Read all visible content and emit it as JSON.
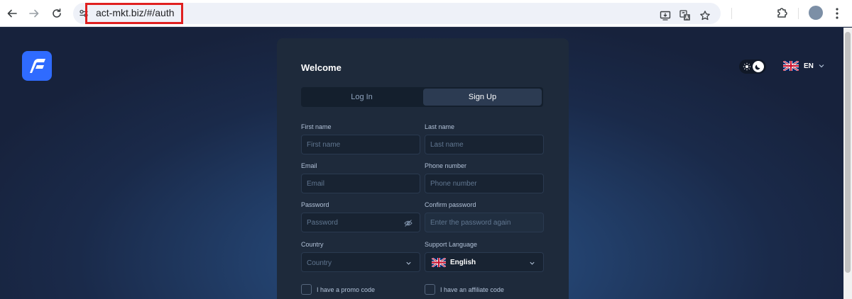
{
  "browser": {
    "url": "act-mkt.biz/#/auth"
  },
  "header": {
    "language_code": "EN"
  },
  "auth": {
    "title": "Welcome",
    "tabs": {
      "login": "Log In",
      "signup": "Sign Up"
    },
    "fields": {
      "first_name": {
        "label": "First name",
        "placeholder": "First name"
      },
      "last_name": {
        "label": "Last name",
        "placeholder": "Last name"
      },
      "email": {
        "label": "Email",
        "placeholder": "Email"
      },
      "phone": {
        "label": "Phone number",
        "placeholder": "Phone number"
      },
      "password": {
        "label": "Password",
        "placeholder": "Password"
      },
      "confirm_password": {
        "label": "Confirm password",
        "placeholder": "Enter the password again"
      },
      "country": {
        "label": "Country",
        "value": "Country"
      },
      "support_language": {
        "label": "Support Language",
        "value": "English"
      }
    },
    "checkboxes": {
      "promo": "I have a promo code",
      "affiliate": "I have an affiliate code"
    }
  },
  "icons": {
    "back": "arrow-left-icon",
    "forward": "arrow-right-icon",
    "reload": "reload-icon",
    "site_info": "site-info-icon",
    "install": "install-app-icon",
    "translate": "translate-icon",
    "bookmark": "star-icon",
    "extensions": "puzzle-icon",
    "menu": "kebab-menu-icon",
    "eye_off": "eye-off-icon",
    "flag": "uk-flag-icon"
  },
  "colors": {
    "accent": "#2f6bff",
    "card": "#1e2a3b",
    "highlight": "#e02020"
  }
}
